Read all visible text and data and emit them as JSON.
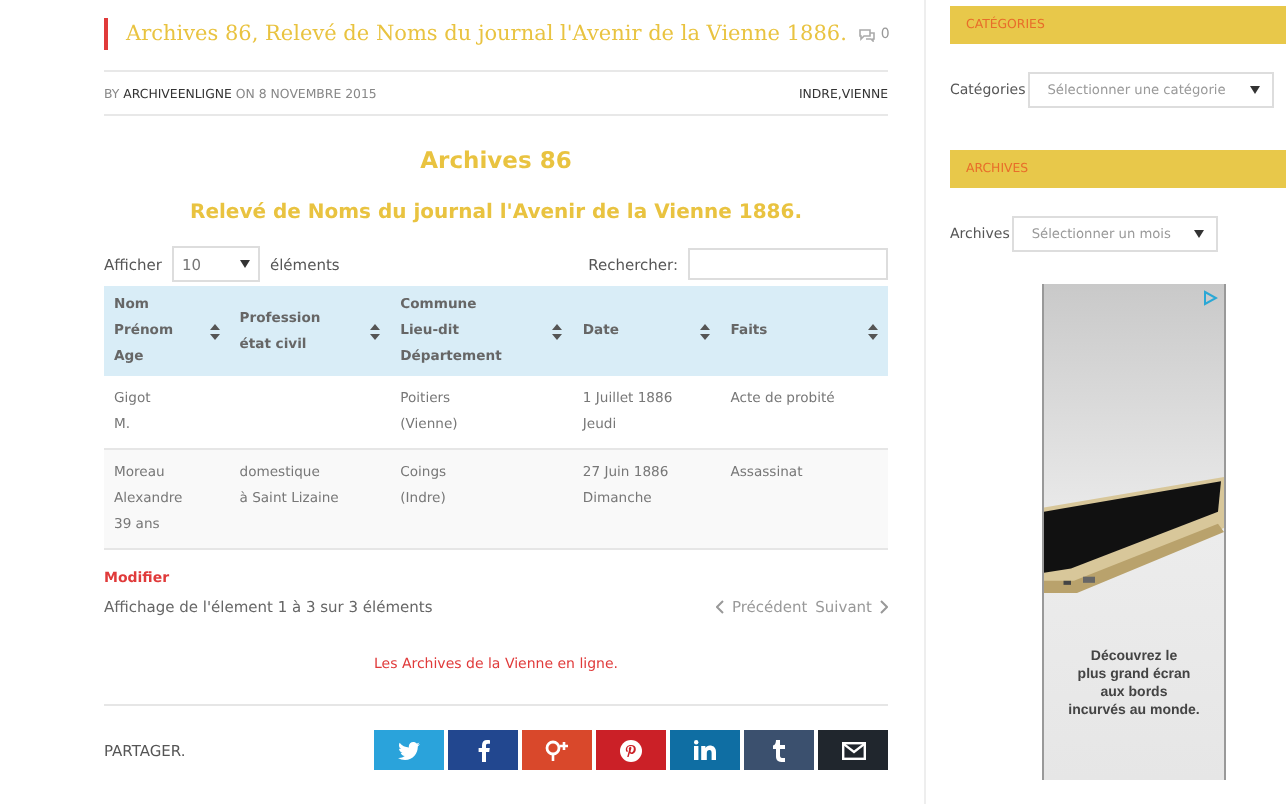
{
  "post": {
    "title": "Archives 86, Relevé de Noms du journal l'Avenir de la Vienne 1886.",
    "comments": "0",
    "byline": {
      "by": "BY",
      "author": "ARCHIVEENLIGNE",
      "date": "ON 8 NOVEMBRE 2015",
      "tags": "INDRE,VIENNE"
    },
    "heading": "Archives 86",
    "subheading": "Relevé de Noms du journal l'Avenir de la Vienne 1886."
  },
  "table_controls": {
    "show_label": "Afficher",
    "show_value": "10",
    "show_suffix": "éléments",
    "search_label": "Rechercher:"
  },
  "table": {
    "columns": [
      "Nom\nPrénom\nAge",
      "Profession\nétat civil",
      "Commune\nLieu-dit\nDépartement",
      "Date",
      "Faits"
    ],
    "rows": [
      [
        "Gigot\nM.",
        "",
        "Poitiers\n(Vienne)",
        "1 Juillet 1886\nJeudi",
        "Acte de probité"
      ],
      [
        "Moreau\nAlexandre\n39 ans",
        "domestique\nà Saint Lizaine",
        "Coings\n(Indre)",
        "27 Juin 1886\nDimanche",
        "Assassinat"
      ]
    ]
  },
  "edit_link": "Modifier",
  "info": "Affichage de l'élement 1 à 3 sur 3 éléments",
  "pagination": {
    "previous": "Précédent",
    "next": "Suivant"
  },
  "footer_link": "Les Archives de la Vienne en ligne.",
  "share": {
    "label": "PARTAGER.",
    "buttons": [
      {
        "kind": "twitter"
      },
      {
        "kind": "facebook"
      },
      {
        "kind": "googleplus"
      },
      {
        "kind": "pinterest"
      },
      {
        "kind": "linkedin"
      },
      {
        "kind": "tumblr"
      },
      {
        "kind": "email"
      }
    ]
  },
  "sidebar": [
    {
      "heading": "CATÉGORIES",
      "label": "Catégories",
      "placeholder": "Sélectionner une catégorie"
    },
    {
      "heading": "ARCHIVES",
      "label": "Archives",
      "placeholder": "Sélectionner un mois"
    }
  ],
  "ad": {
    "kind": "picture",
    "text": "Découvrez le\nplus grand écran\naux bords\nincurvés au monde."
  }
}
